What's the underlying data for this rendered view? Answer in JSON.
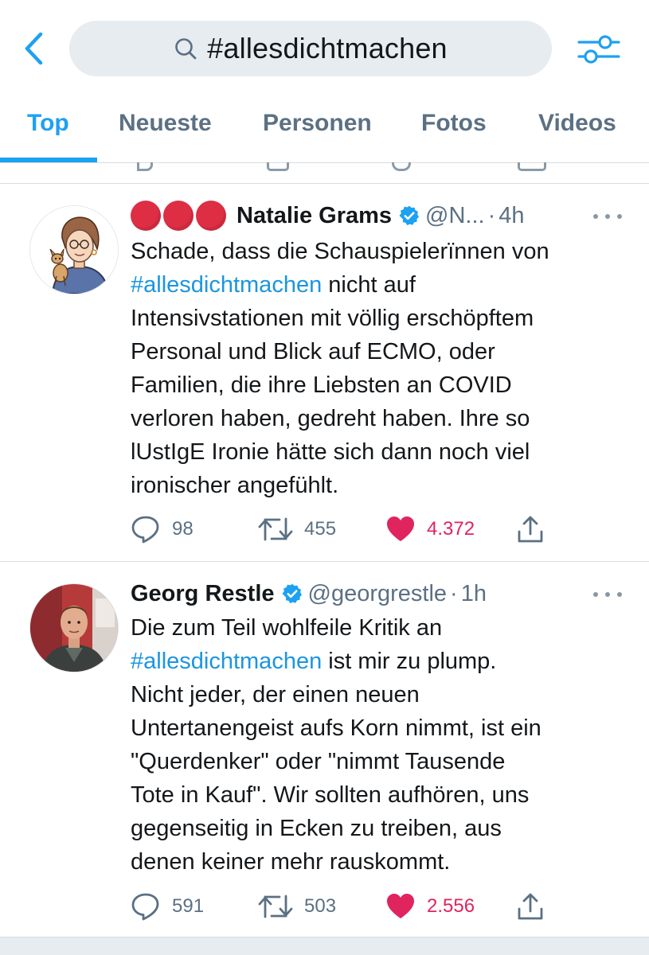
{
  "search": {
    "query": "#allesdichtmachen"
  },
  "tabs": [
    {
      "label": "Top",
      "active": true
    },
    {
      "label": "Neueste",
      "active": false
    },
    {
      "label": "Personen",
      "active": false
    },
    {
      "label": "Fotos",
      "active": false
    },
    {
      "label": "Videos",
      "active": false
    }
  ],
  "icons": {
    "back": "chevron-left-icon",
    "search": "search-icon",
    "filter": "filter-sliders-icon",
    "verified": "verified-badge-icon",
    "reply": "reply-icon",
    "retweet": "retweet-icon",
    "like": "heart-icon",
    "share": "share-icon",
    "more": "more-icon"
  },
  "colors": {
    "accent": "#1da1f2",
    "hashtag": "#1b95e0",
    "like_active": "#e0245e",
    "secondary_text": "#5b7083",
    "red_circle": "#dd2e44"
  },
  "tweets": [
    {
      "display_name": "Natalie Grams",
      "name_prefix_emoji": "red-circle x3",
      "handle": "@N...",
      "time": "4h",
      "lines": [
        [
          {
            "t": "Schade, dass die Schauspielerïnnen von"
          }
        ],
        [
          {
            "t": "#allesdichtmachen",
            "tag": true
          },
          {
            "t": " nicht auf"
          }
        ],
        [
          {
            "t": "Intensivstationen mit völlig erschöpftem"
          }
        ],
        [
          {
            "t": "Personal und Blick auf ECMO, oder"
          }
        ],
        [
          {
            "t": "Familien, die ihre Liebsten an COVID"
          }
        ],
        [
          {
            "t": "verloren haben, gedreht haben. Ihre so"
          }
        ],
        [
          {
            "t": "lUstIgE Ironie hätte sich dann noch viel"
          }
        ],
        [
          {
            "t": "ironischer angefühlt."
          }
        ]
      ],
      "replies": "98",
      "retweets": "455",
      "likes": "4.372",
      "liked": true
    },
    {
      "display_name": "Georg Restle",
      "handle": "@georgrestle",
      "time": "1h",
      "lines": [
        [
          {
            "t": "Die zum Teil wohlfeile Kritik an"
          }
        ],
        [
          {
            "t": "#allesdichtmachen",
            "tag": true
          },
          {
            "t": " ist mir zu plump."
          }
        ],
        [
          {
            "t": "Nicht jeder, der einen neuen"
          }
        ],
        [
          {
            "t": "Untertanengeist aufs Korn nimmt, ist ein"
          }
        ],
        [
          {
            "t": "\"Querdenker\" oder \"nimmt Tausende"
          }
        ],
        [
          {
            "t": "Tote in Kauf\". Wir sollten aufhören, uns"
          }
        ],
        [
          {
            "t": "gegenseitig in Ecken zu treiben, aus"
          }
        ],
        [
          {
            "t": "denen keiner mehr rauskommt."
          }
        ]
      ],
      "replies": "591",
      "retweets": "503",
      "likes": "2.556",
      "liked": true
    }
  ]
}
